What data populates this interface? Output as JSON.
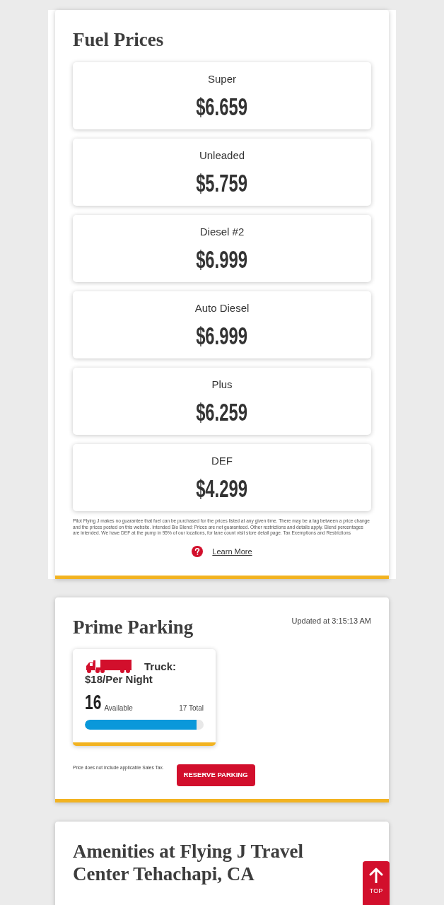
{
  "fuel_prices": {
    "title": "Fuel Prices",
    "prices": [
      {
        "grade": "Super",
        "price": "$6.659"
      },
      {
        "grade": "Unleaded",
        "price": "$5.759"
      },
      {
        "grade": "Diesel #2",
        "price": "$6.999"
      },
      {
        "grade": "Auto Diesel",
        "price": "$6.999"
      },
      {
        "grade": "Plus",
        "price": "$6.259"
      },
      {
        "grade": "DEF",
        "price": "$4.299"
      }
    ],
    "disclaimer": "Pilot Flying J makes no guarantee that fuel can be purchased for the prices listed at any given time. There may be a lag between a price change and the prices posted on this website. Intended Bio Blend: Prices are not guaranteed. Other restrictions and details apply. Blend percentages are intended. We have DEF at the pump in 95% of our locations, for lane count visit store detail page. Tax Exemptions and Restrictions",
    "learn_more": "Learn More"
  },
  "prime_parking": {
    "title": "Prime Parking",
    "updated": "Updated at 3:15:13 AM",
    "spots": [
      {
        "vehicle": "Truck:",
        "rate": "$18/Per Night",
        "available": "16",
        "available_label": "Available",
        "total": "17 Total",
        "level": 0.94
      }
    ],
    "tax_note": "Price does not include applicable Sales Tax.",
    "reserve_button": "RESERVE PARKING"
  },
  "amenities": {
    "title": "Amenities at Flying J Travel Center Tehachapi, CA"
  },
  "top_button": "TOP"
}
